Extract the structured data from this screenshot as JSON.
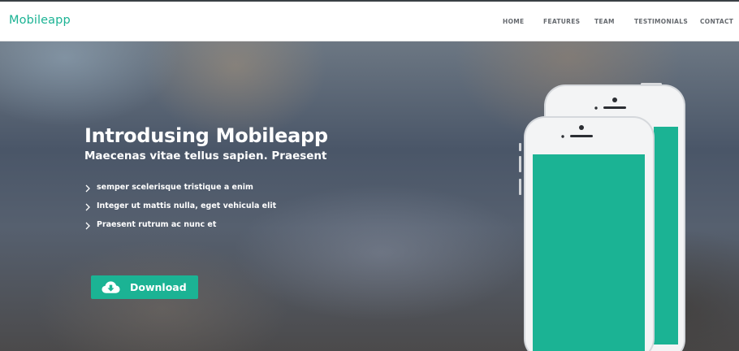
{
  "brand": {
    "name": "Mobileapp"
  },
  "nav": {
    "items": [
      {
        "label": "HOME"
      },
      {
        "label": "FEATURES"
      },
      {
        "label": "TEAM"
      },
      {
        "label": "TESTIMONIALS"
      },
      {
        "label": "CONTACT"
      }
    ]
  },
  "hero": {
    "title": "Introdusing Mobileapp",
    "subtitle": "Maecenas vitae tellus sapien. Praesent",
    "features": [
      {
        "text": "semper scelerisque tristique a enim",
        "icon": "chevron-right-icon"
      },
      {
        "text": "Integer ut mattis nulla, eget vehicula elit",
        "icon": "chevron-right-icon"
      },
      {
        "text": "Praesent rutrum ac nunc et",
        "icon": "chevron-right-icon"
      }
    ],
    "download": {
      "label": "Download",
      "icon": "cloud-download-icon"
    }
  },
  "colors": {
    "accent": "#1bb394",
    "nav_text": "#666a6f",
    "phone_body": "#f2f3f4",
    "phone_screen": "#1bb394"
  }
}
